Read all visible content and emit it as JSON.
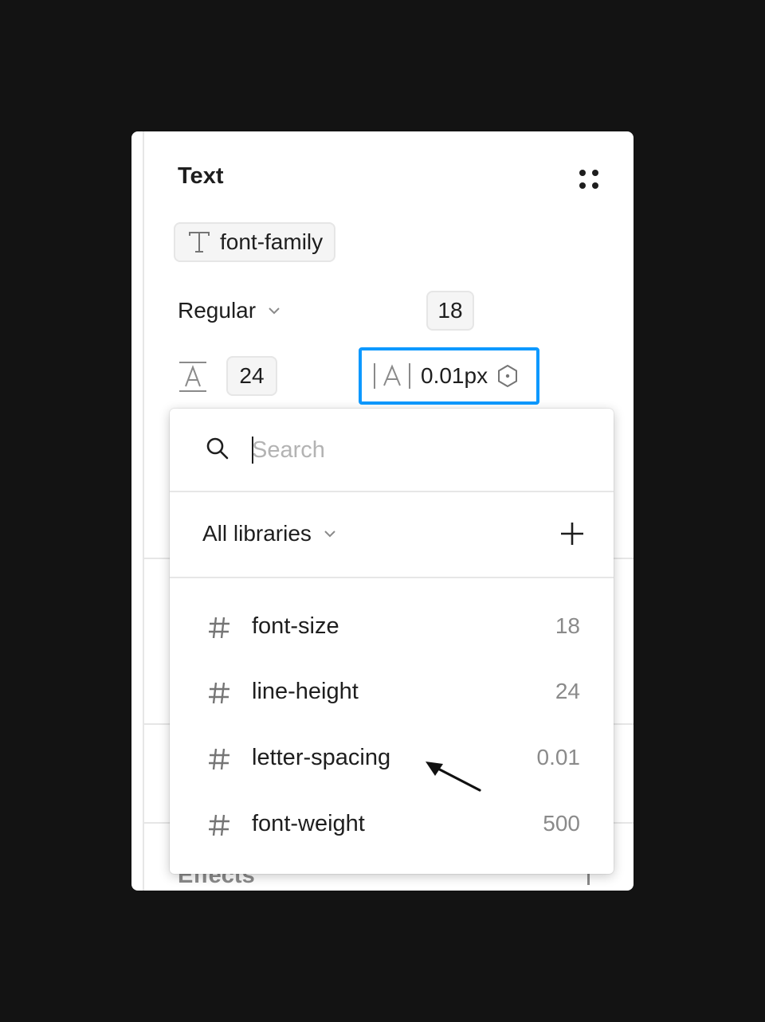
{
  "panel": {
    "title": "Text",
    "font_family_label": "font-family",
    "weight_label": "Regular",
    "font_size_value": "18",
    "line_height_value": "24",
    "letter_spacing_value": "0.01px",
    "partially_hidden_section": "Effects"
  },
  "dropdown": {
    "search_placeholder": "Search",
    "search_value": "",
    "library_label": "All libraries",
    "variables": [
      {
        "name": "font-size",
        "value": "18"
      },
      {
        "name": "line-height",
        "value": "24"
      },
      {
        "name": "letter-spacing",
        "value": "0.01"
      },
      {
        "name": "font-weight",
        "value": "500"
      }
    ]
  },
  "colors": {
    "accent_focus": "#0d99ff",
    "background": "#131313"
  },
  "icons": [
    "styles-icon",
    "text-t-icon",
    "chevron-down-icon",
    "line-height-icon",
    "letter-spacing-icon",
    "variable-hex-icon",
    "search-icon",
    "plus-icon",
    "hash-icon",
    "annotation-arrow-icon"
  ]
}
